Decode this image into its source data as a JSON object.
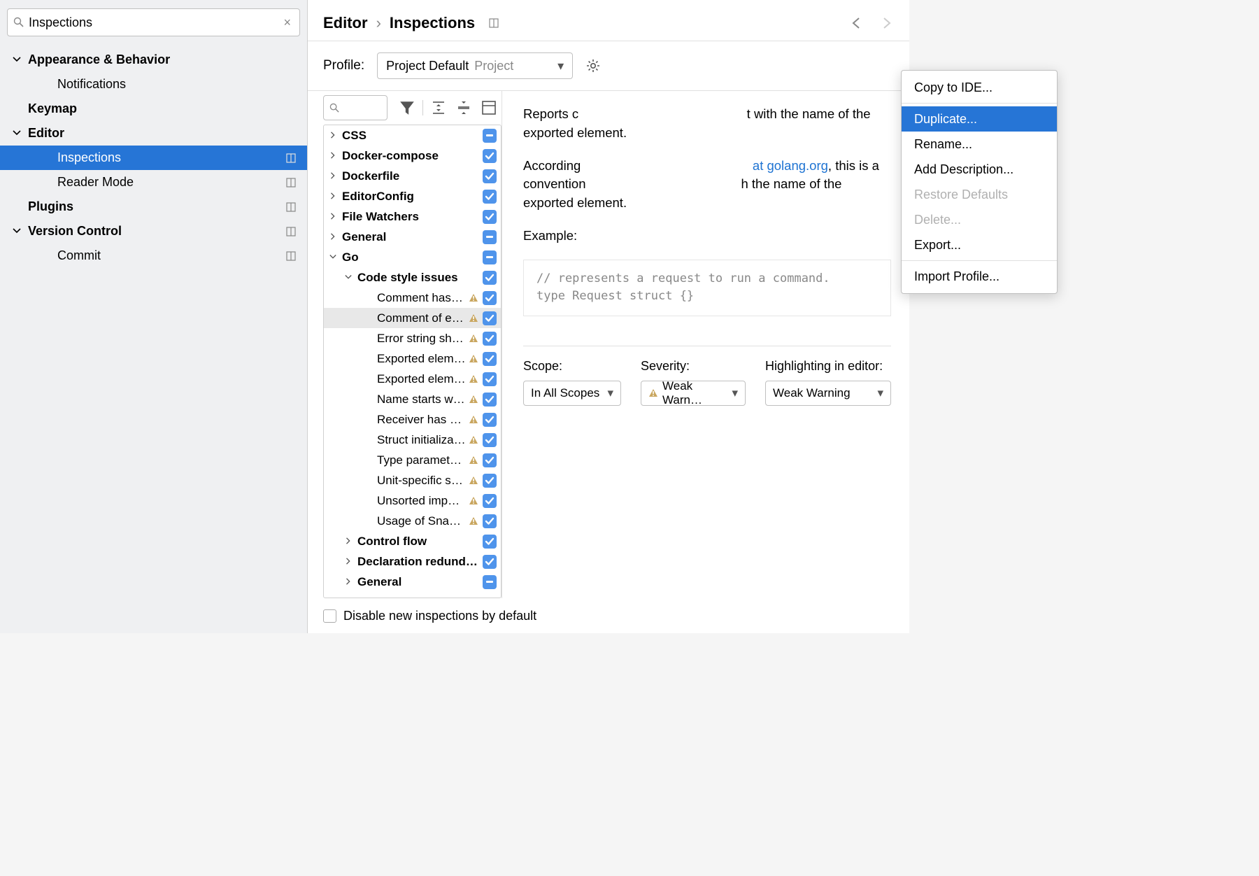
{
  "sidebar": {
    "search_value": "Inspections",
    "items": [
      {
        "label": "Appearance & Behavior",
        "bold": true,
        "chev": "down",
        "depth": 1
      },
      {
        "label": "Notifications",
        "bold": false,
        "chev": "none",
        "depth": 2
      },
      {
        "label": "Keymap",
        "bold": true,
        "chev": "none",
        "depth": 1
      },
      {
        "label": "Editor",
        "bold": true,
        "chev": "down",
        "depth": 1
      },
      {
        "label": "Inspections",
        "bold": false,
        "chev": "none",
        "depth": 2,
        "selected": true,
        "div": true
      },
      {
        "label": "Reader Mode",
        "bold": false,
        "chev": "none",
        "depth": 2,
        "div": true
      },
      {
        "label": "Plugins",
        "bold": true,
        "chev": "none",
        "depth": 1,
        "div": true
      },
      {
        "label": "Version Control",
        "bold": true,
        "chev": "down",
        "depth": 1,
        "div": true
      },
      {
        "label": "Commit",
        "bold": false,
        "chev": "none",
        "depth": 2,
        "div": true
      }
    ]
  },
  "header": {
    "crumb1": "Editor",
    "crumb2": "Inspections"
  },
  "profile": {
    "label": "Profile:",
    "name": "Project Default",
    "scope": "Project"
  },
  "inspTree": [
    {
      "label": "CSS",
      "depth": 0,
      "chev": "right",
      "bold": true,
      "chk": "mixed"
    },
    {
      "label": "Docker-compose",
      "depth": 0,
      "chev": "right",
      "bold": true,
      "chk": "checked"
    },
    {
      "label": "Dockerfile",
      "depth": 0,
      "chev": "right",
      "bold": true,
      "chk": "checked"
    },
    {
      "label": "EditorConfig",
      "depth": 0,
      "chev": "right",
      "bold": true,
      "chk": "checked"
    },
    {
      "label": "File Watchers",
      "depth": 0,
      "chev": "right",
      "bold": true,
      "chk": "checked"
    },
    {
      "label": "General",
      "depth": 0,
      "chev": "right",
      "bold": true,
      "chk": "mixed"
    },
    {
      "label": "Go",
      "depth": 0,
      "chev": "down",
      "bold": true,
      "chk": "mixed"
    },
    {
      "label": "Code style issues",
      "depth": 1,
      "chev": "down",
      "bold": true,
      "chk": "checked"
    },
    {
      "label": "Comment has no leading space",
      "depth": 2,
      "chev": "none",
      "bold": false,
      "chk": "checked",
      "warn": true
    },
    {
      "label": "Comment of exported element starts with the incorrect name",
      "depth": 2,
      "chev": "none",
      "bold": false,
      "chk": "checked",
      "warn": true,
      "sel": true
    },
    {
      "label": "Error string should not be capitalized or end with punctuation",
      "depth": 2,
      "chev": "none",
      "bold": false,
      "chk": "checked",
      "warn": true
    },
    {
      "label": "Exported element should have a comment",
      "depth": 2,
      "chev": "none",
      "bold": false,
      "chk": "checked",
      "warn": true
    },
    {
      "label": "Exported element should have its own declaration",
      "depth": 2,
      "chev": "none",
      "bold": false,
      "chk": "checked",
      "warn": true
    },
    {
      "label": "Name starts with a package name",
      "depth": 2,
      "chev": "none",
      "bold": false,
      "chk": "checked",
      "warn": true
    },
    {
      "label": "Receiver has a generic name",
      "depth": 2,
      "chev": "none",
      "bold": false,
      "chk": "checked",
      "warn": true
    },
    {
      "label": "Struct initialization without field names",
      "depth": 2,
      "chev": "none",
      "bold": false,
      "chk": "checked",
      "warn": true
    },
    {
      "label": "Type parameter is declared in lowercase",
      "depth": 2,
      "chev": "none",
      "bold": false,
      "chk": "checked",
      "warn": true
    },
    {
      "label": "Unit-specific suffix for 'time.Duration'",
      "depth": 2,
      "chev": "none",
      "bold": false,
      "chk": "checked",
      "warn": true
    },
    {
      "label": "Unsorted imports",
      "depth": 2,
      "chev": "none",
      "bold": false,
      "chk": "checked",
      "warn": true
    },
    {
      "label": "Usage of Snake_Case",
      "depth": 2,
      "chev": "none",
      "bold": false,
      "chk": "checked",
      "warn": true
    },
    {
      "label": "Control flow",
      "depth": 1,
      "chev": "right",
      "bold": true,
      "chk": "checked"
    },
    {
      "label": "Declaration redundancy",
      "depth": 1,
      "chev": "right",
      "bold": true,
      "chk": "checked"
    },
    {
      "label": "General",
      "depth": 1,
      "chev": "right",
      "bold": true,
      "chk": "mixed"
    }
  ],
  "detail": {
    "p1a": "Reports c",
    "p1b": "t with the name of the exported element.",
    "p2a": "According ",
    "p2_link": "at golang.org",
    "p2b": ", this is a convention",
    "p2c": "h the name of the exported element.",
    "example_label": "Example:",
    "code_l1": "// represents a request to run a command.",
    "code_l2": "type Request struct {}",
    "scope_label": "Scope:",
    "scope_value": "In All Scopes",
    "severity_label": "Severity:",
    "severity_value": "Weak Warn…",
    "highlight_label": "Highlighting in editor:",
    "highlight_value": "Weak Warning"
  },
  "footer": {
    "disable_label": "Disable new inspections by default"
  },
  "popup": {
    "items": [
      {
        "label": "Copy to IDE...",
        "state": "normal"
      },
      {
        "sep": true
      },
      {
        "label": "Duplicate...",
        "state": "highlight"
      },
      {
        "label": "Rename...",
        "state": "normal"
      },
      {
        "label": "Add Description...",
        "state": "normal"
      },
      {
        "label": "Restore Defaults",
        "state": "disabled"
      },
      {
        "label": "Delete...",
        "state": "disabled"
      },
      {
        "label": "Export...",
        "state": "normal"
      },
      {
        "sep": true
      },
      {
        "label": "Import Profile...",
        "state": "normal"
      }
    ]
  }
}
